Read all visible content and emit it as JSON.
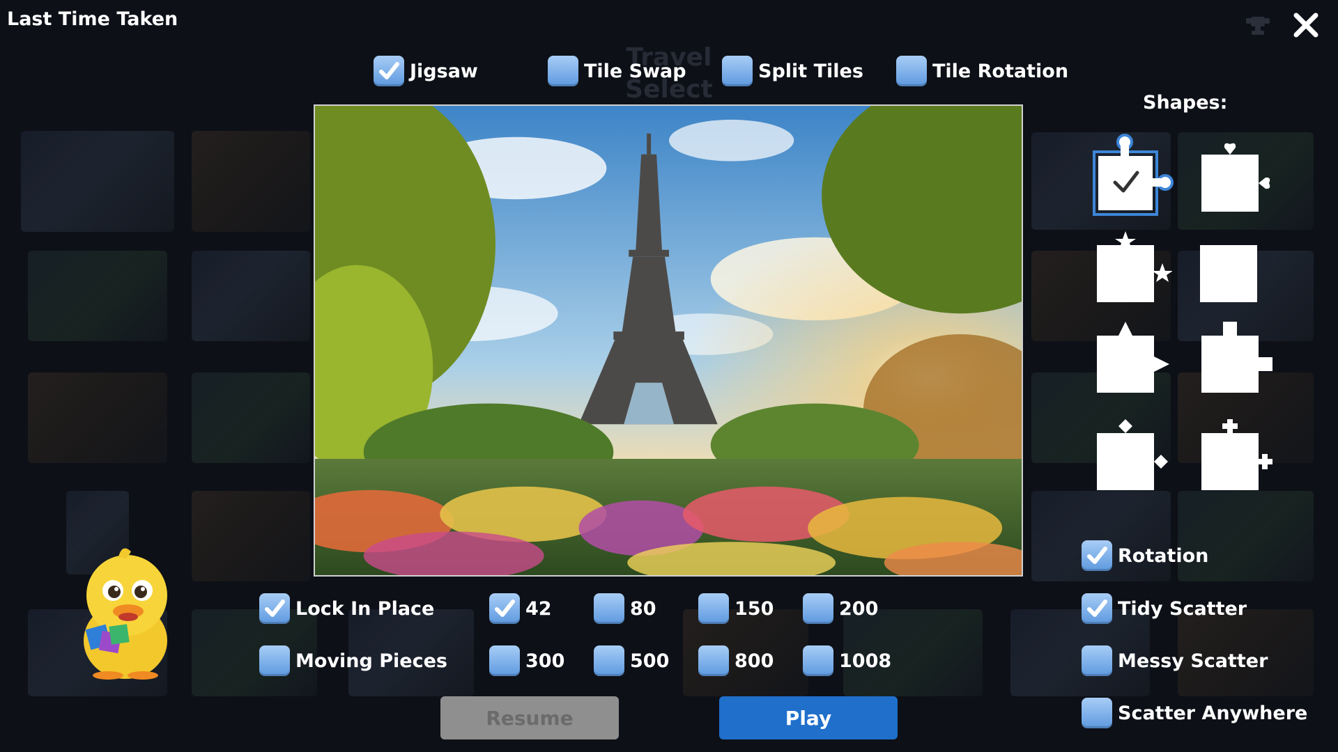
{
  "header": {
    "title": "Last Time Taken",
    "background_heading": [
      "Travel",
      "Select Image"
    ]
  },
  "modes": [
    {
      "label": "Jigsaw",
      "checked": true
    },
    {
      "label": "Tile Swap",
      "checked": false
    },
    {
      "label": "Split Tiles",
      "checked": false
    },
    {
      "label": "Tile Rotation",
      "checked": false
    }
  ],
  "shapes": {
    "label": "Shapes:",
    "items": [
      {
        "name": "circle-knob",
        "selected": true
      },
      {
        "name": "heart-knob",
        "selected": false
      },
      {
        "name": "star-knob",
        "selected": false
      },
      {
        "name": "plain-square",
        "selected": false
      },
      {
        "name": "triangle-knob",
        "selected": false
      },
      {
        "name": "square-knob",
        "selected": false
      },
      {
        "name": "diamond-knob",
        "selected": false
      },
      {
        "name": "cross-knob",
        "selected": false
      }
    ]
  },
  "placement": [
    {
      "label": "Lock In Place",
      "checked": true
    },
    {
      "label": "Moving Pieces",
      "checked": false
    }
  ],
  "piece_counts": [
    {
      "label": "42",
      "checked": true
    },
    {
      "label": "80",
      "checked": false
    },
    {
      "label": "150",
      "checked": false
    },
    {
      "label": "200",
      "checked": false
    },
    {
      "label": "300",
      "checked": false
    },
    {
      "label": "500",
      "checked": false
    },
    {
      "label": "800",
      "checked": false
    },
    {
      "label": "1008",
      "checked": false
    }
  ],
  "options": [
    {
      "label": "Rotation",
      "checked": true
    },
    {
      "label": "Tidy Scatter",
      "checked": true
    },
    {
      "label": "Messy Scatter",
      "checked": false
    },
    {
      "label": "Scatter Anywhere",
      "checked": false
    }
  ],
  "buttons": {
    "resume": "Resume",
    "play": "Play"
  },
  "colors": {
    "checkbox": "#7fb3ee",
    "play": "#1f6fcb",
    "resume": "#8f8f8f",
    "selected_shape": "#3d86d8",
    "background": "#0d1017"
  }
}
